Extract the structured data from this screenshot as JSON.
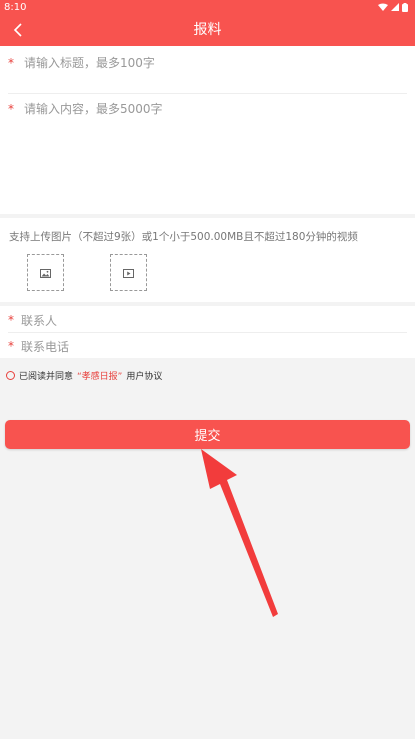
{
  "status_bar": {
    "time": "8:10",
    "icons": [
      "wifi-icon",
      "signal-icon",
      "battery-icon"
    ]
  },
  "nav": {
    "title": "报料",
    "back_icon": "chevron-left-icon"
  },
  "form": {
    "required_mark": "*",
    "title_placeholder": "请输入标题，最多100字",
    "content_placeholder": "请输入内容，最多5000字"
  },
  "upload": {
    "hint": "支持上传图片（不超过9张）或1个小于500.00MB且不超过180分钟的视频",
    "image_icon": "image-icon",
    "video_icon": "video-icon"
  },
  "contact": {
    "name_placeholder": "联系人",
    "phone_placeholder": "联系电话"
  },
  "agreement": {
    "prefix": "已阅读并同意",
    "brand": "“孝感日报”",
    "suffix": "用户协议"
  },
  "submit_label": "提交",
  "colors": {
    "accent": "#f8534f",
    "required": "#e8403c",
    "background": "#f3f3f3"
  }
}
